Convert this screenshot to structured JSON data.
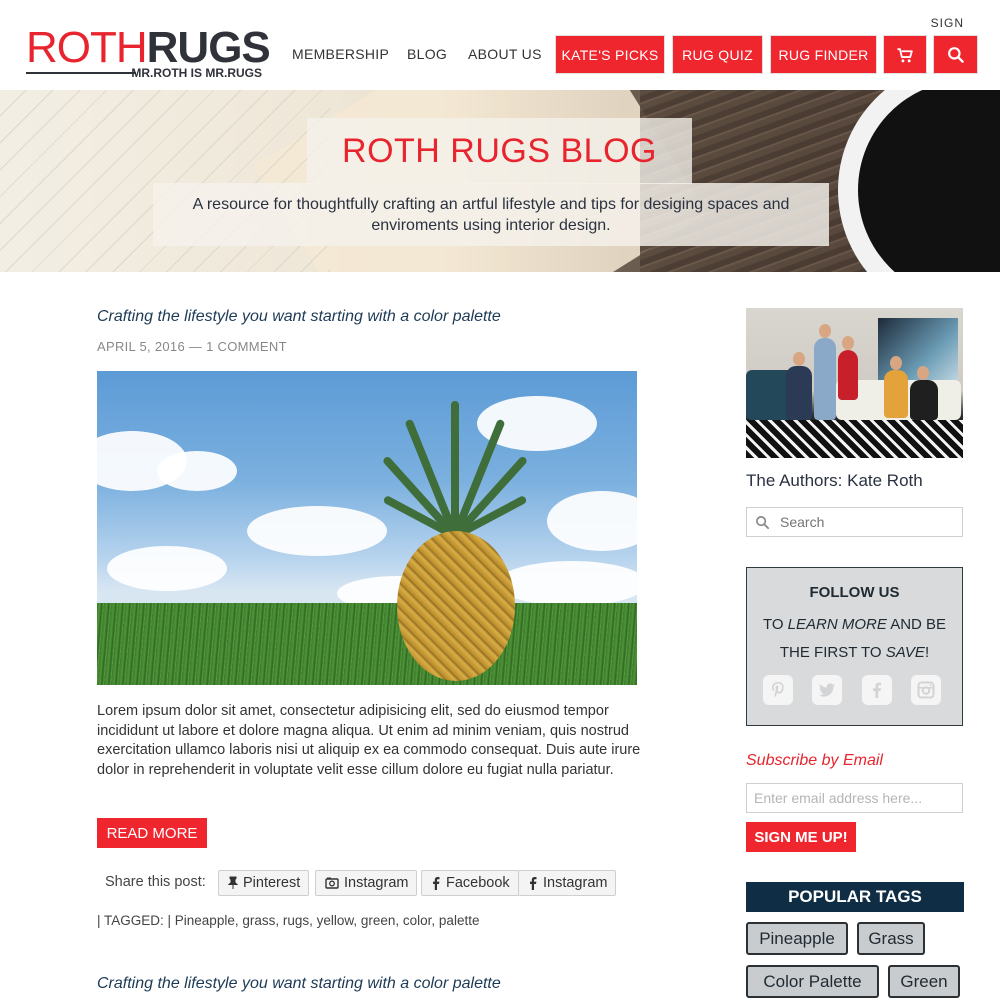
{
  "header": {
    "logo": {
      "roth": "ROTH",
      "rugs": "RUGS",
      "tagline": "MR.ROTH IS MR.RUGS"
    },
    "sign_link": "SIGN",
    "nav": [
      "MEMBERSHIP",
      "BLOG",
      "ABOUT US"
    ],
    "action_buttons": [
      "KATE'S PICKS",
      "RUG QUIZ",
      "RUG FINDER"
    ],
    "icons": [
      "cart-icon",
      "search-icon"
    ]
  },
  "hero": {
    "title": "ROTH RUGS BLOG",
    "subtitle": "A resource for thoughtfully crafting an artful lifestyle and tips for desiging spaces and enviroments using interior design."
  },
  "post": {
    "title": "Crafting the  lifestyle you want starting with a color palette",
    "date": "APRIL 5, 2016",
    "comments": "1 COMMENT",
    "body": "Lorem ipsum dolor sit amet, consectetur adipisicing elit, sed do eiusmod tempor incididunt ut labore et dolore magna aliqua. Ut enim ad minim veniam, quis nostrud exercitation ullamco laboris nisi ut aliquip ex ea commodo consequat. Duis aute irure dolor in reprehenderit in voluptate velit esse cillum dolore eu fugiat nulla pariatur.",
    "read_more": "READ MORE",
    "share_label": "Share this post:",
    "share_buttons": [
      "Pinterest",
      "Instagram",
      "Facebook",
      "Instagram"
    ],
    "tagged_line": "| TAGGED: | Pineapple, grass, rugs, yellow, green, color, palette"
  },
  "next_post": {
    "title": "Crafting the  lifestyle you want starting with a color palette"
  },
  "sidebar": {
    "author_caption": "The  Authors: Kate Roth",
    "search_placeholder": "Search",
    "follow": {
      "title": "FOLLOW US",
      "line1_a": "TO ",
      "line1_em": "LEARN MORE",
      "line1_b": " AND BE",
      "line2_a": "THE FIRST TO ",
      "line2_em": "SAVE",
      "line2_b": "!",
      "icons": [
        "pinterest-icon",
        "twitter-icon",
        "facebook-icon",
        "instagram-icon"
      ]
    },
    "subscribe_title": "Subscribe by Email",
    "email_placeholder": "Enter email address here...",
    "sign_up": "SIGN ME UP!",
    "popular_tags_title": "POPULAR TAGS",
    "tags": [
      "Pineapple",
      "Grass",
      "Color Palette",
      "Green"
    ]
  },
  "colors": {
    "accent_red": "#f0262f",
    "navy": "#0f2e45",
    "dark_text": "#2a3140"
  }
}
